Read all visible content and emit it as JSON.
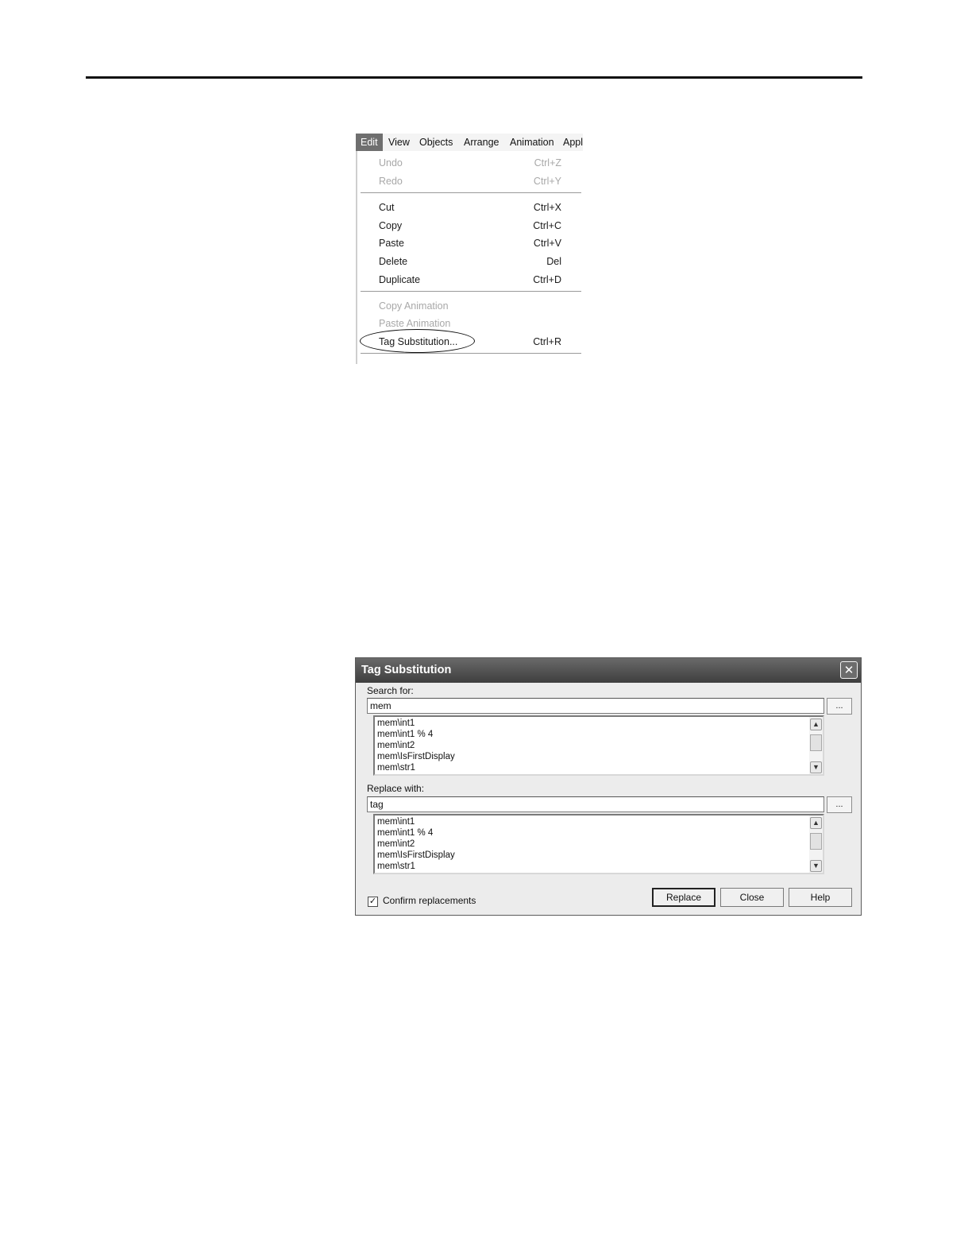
{
  "menubar": {
    "items": [
      {
        "label": "Edit",
        "active": true
      },
      {
        "label": "View"
      },
      {
        "label": "Objects"
      },
      {
        "label": "Arrange"
      },
      {
        "label": "Animation"
      },
      {
        "label": "Appli"
      }
    ]
  },
  "edit_menu": {
    "items": [
      {
        "label": "Undo",
        "shortcut": "Ctrl+Z",
        "disabled": true
      },
      {
        "label": "Redo",
        "shortcut": "Ctrl+Y",
        "disabled": true
      },
      {
        "label": "Cut",
        "shortcut": "Ctrl+X"
      },
      {
        "label": "Copy",
        "shortcut": "Ctrl+C"
      },
      {
        "label": "Paste",
        "shortcut": "Ctrl+V"
      },
      {
        "label": "Delete",
        "shortcut": "Del"
      },
      {
        "label": "Duplicate",
        "shortcut": "Ctrl+D"
      },
      {
        "label": "Copy Animation",
        "shortcut": "",
        "disabled": true
      },
      {
        "label": "Paste Animation",
        "shortcut": "",
        "disabled": true
      },
      {
        "label": "Tag Substitution...",
        "shortcut": "Ctrl+R",
        "circled": true
      }
    ]
  },
  "dialog": {
    "title": "Tag Substitution",
    "close_glyph": "✕",
    "search": {
      "label": "Search for:",
      "value": "mem",
      "browse_label": "...",
      "list": [
        "mem\\int1",
        "mem\\int1 % 4",
        "mem\\int2",
        "mem\\IsFirstDisplay",
        "mem\\str1"
      ]
    },
    "replace": {
      "label": "Replace with:",
      "value": "tag",
      "browse_label": "...",
      "list": [
        "mem\\int1",
        "mem\\int1 % 4",
        "mem\\int2",
        "mem\\IsFirstDisplay",
        "mem\\str1"
      ]
    },
    "scroll_up_glyph": "▲",
    "scroll_down_glyph": "▼",
    "confirm": {
      "label": "Confirm replacements",
      "checked": true,
      "check_glyph": "✓"
    },
    "buttons": {
      "replace": "Replace",
      "close": "Close",
      "help": "Help"
    }
  },
  "colors": {
    "titlebar": "#4a4a4a",
    "dialog_bg": "#ececec",
    "menu_active": "#6f6f6f",
    "disabled_text": "#a8a8a8"
  }
}
